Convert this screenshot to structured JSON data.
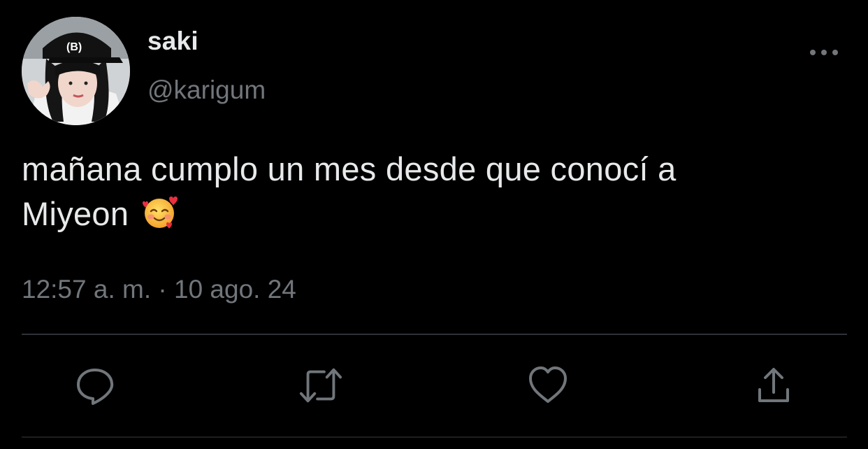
{
  "author": {
    "display_name": "saki",
    "handle": "@karigum"
  },
  "tweet": {
    "text_line1": "mañana cumplo un mes desde que conocí a",
    "text_line2": "Miyeon",
    "emoji": "smiling-face-with-hearts",
    "time": "12:57 a. m.",
    "separator": "·",
    "date": "10 ago. 24"
  },
  "actions": [
    {
      "name": "reply",
      "icon": "speech-bubble-icon"
    },
    {
      "name": "retweet",
      "icon": "retweet-arrows-icon"
    },
    {
      "name": "like",
      "icon": "heart-icon"
    },
    {
      "name": "share",
      "icon": "share-upload-icon"
    }
  ],
  "colors": {
    "background": "#000000",
    "primary_text": "#e7e9ea",
    "secondary_text": "#71767b",
    "divider": "#2f3336"
  }
}
